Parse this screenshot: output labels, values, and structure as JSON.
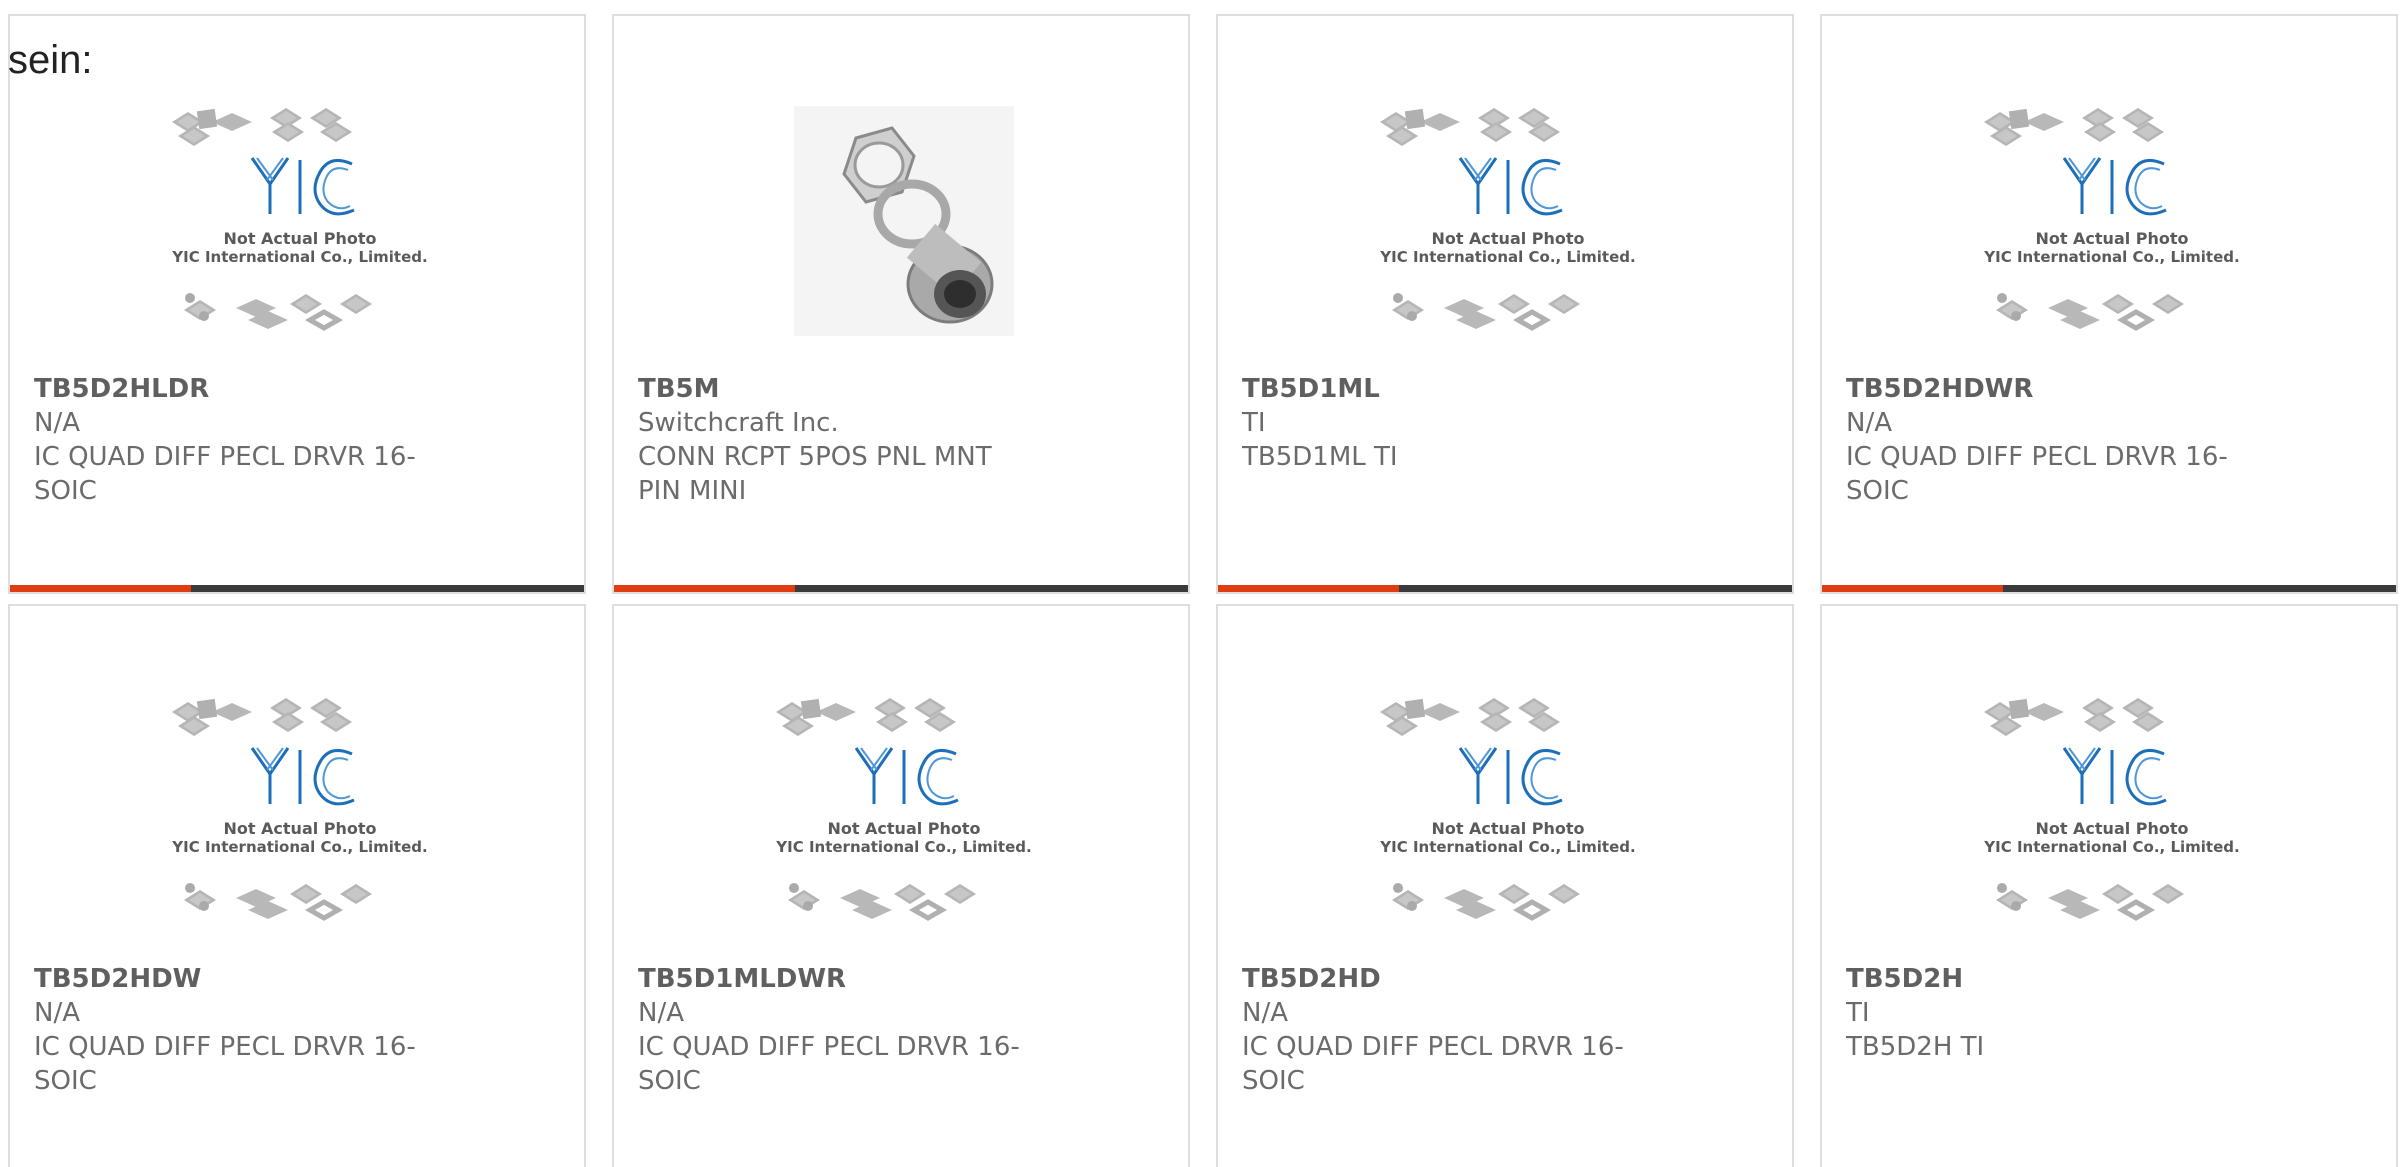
{
  "lead_text": "sein:",
  "colors": {
    "accent": "#e03c12",
    "bar": "#3a3a3a",
    "logo_blue": "#1c6fb8",
    "text_gray": "#6b6b6b"
  },
  "placeholder": {
    "line1": "Not Actual Photo",
    "line2": "YIC International Co., Limited.",
    "logo_letters": "YIC"
  },
  "products": [
    {
      "part": "TB5D2HLDR",
      "maker": "N/A",
      "description": "IC QUAD DIFF PECL DRVR 16-SOIC",
      "image": "placeholder"
    },
    {
      "part": "TB5M",
      "maker": "Switchcraft Inc.",
      "description": "CONN RCPT 5POS PNL MNT PIN MINI",
      "image": "connector-photo"
    },
    {
      "part": "TB5D1ML",
      "maker": "TI",
      "description": "TB5D1ML TI",
      "image": "placeholder"
    },
    {
      "part": "TB5D2HDWR",
      "maker": "N/A",
      "description": "IC QUAD DIFF PECL DRVR 16-SOIC",
      "image": "placeholder"
    },
    {
      "part": "TB5D2HDW",
      "maker": "N/A",
      "description": "IC QUAD DIFF PECL DRVR 16-SOIC",
      "image": "placeholder"
    },
    {
      "part": "TB5D1MLDWR",
      "maker": "N/A",
      "description": "IC QUAD DIFF PECL DRVR 16-SOIC",
      "image": "placeholder"
    },
    {
      "part": "TB5D2HD",
      "maker": "N/A",
      "description": "IC QUAD DIFF PECL DRVR 16-SOIC",
      "image": "placeholder"
    },
    {
      "part": "TB5D2H",
      "maker": "TI",
      "description": "TB5D2H TI",
      "image": "placeholder"
    }
  ]
}
